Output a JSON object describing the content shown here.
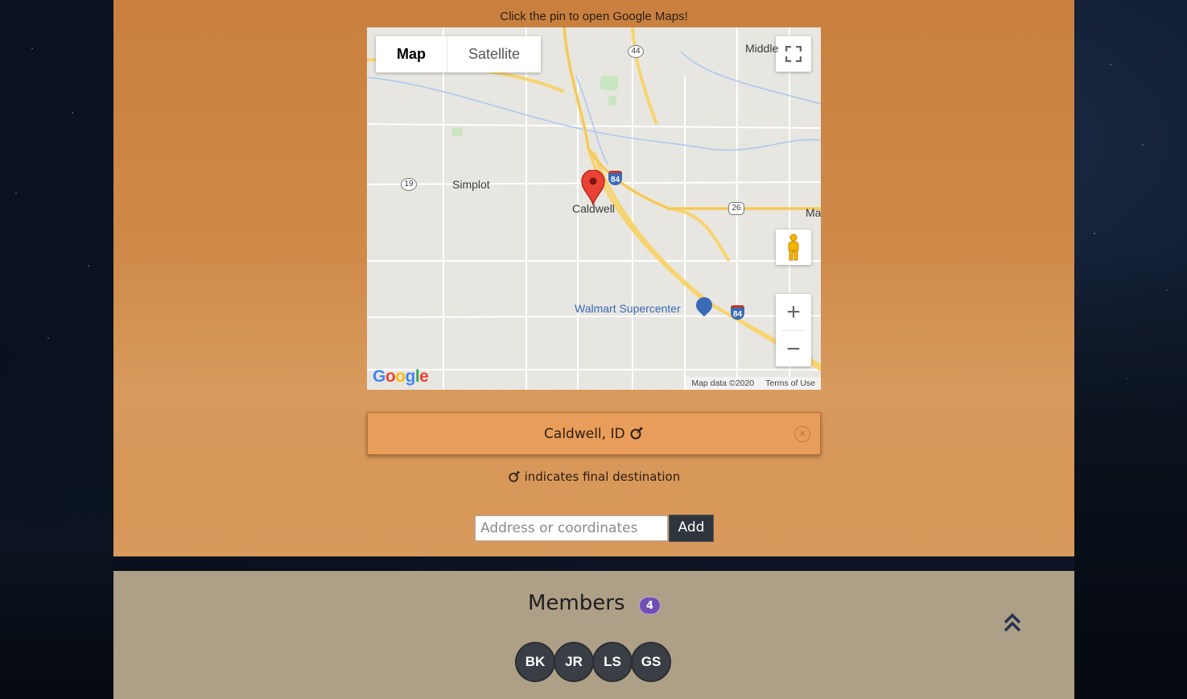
{
  "hint": "Click the pin to open Google Maps!",
  "map": {
    "type_map": "Map",
    "type_satellite": "Satellite",
    "labels": {
      "middle": "Middle",
      "simplot": "Simplot",
      "caldwell": "Caldwell",
      "walmart": "Walmart Supercenter",
      "ma": "Ma",
      "r19": "19",
      "r44": "44",
      "r26": "26",
      "i84a": "84",
      "i84b": "84"
    },
    "zoom_in": "+",
    "zoom_out": "−",
    "footer_data": "Map data ©2020",
    "footer_terms": "Terms of Use",
    "logo": "Google"
  },
  "destination": {
    "label": "Caldwell, ID",
    "icon": "flag-icon",
    "close_icon": "close-icon"
  },
  "legend": "indicates final destination",
  "address": {
    "placeholder": "Address or coordinates",
    "add_label": "Add"
  },
  "members": {
    "title": "Members",
    "count": "4",
    "list": [
      "BK",
      "JR",
      "LS",
      "GS"
    ]
  },
  "colors": {
    "top_panel": "#c9803f",
    "bottom_panel": "#aea087",
    "destination_card": "#e89d5a",
    "badge": "#6f4fb3",
    "avatar": "#3a3f46"
  }
}
